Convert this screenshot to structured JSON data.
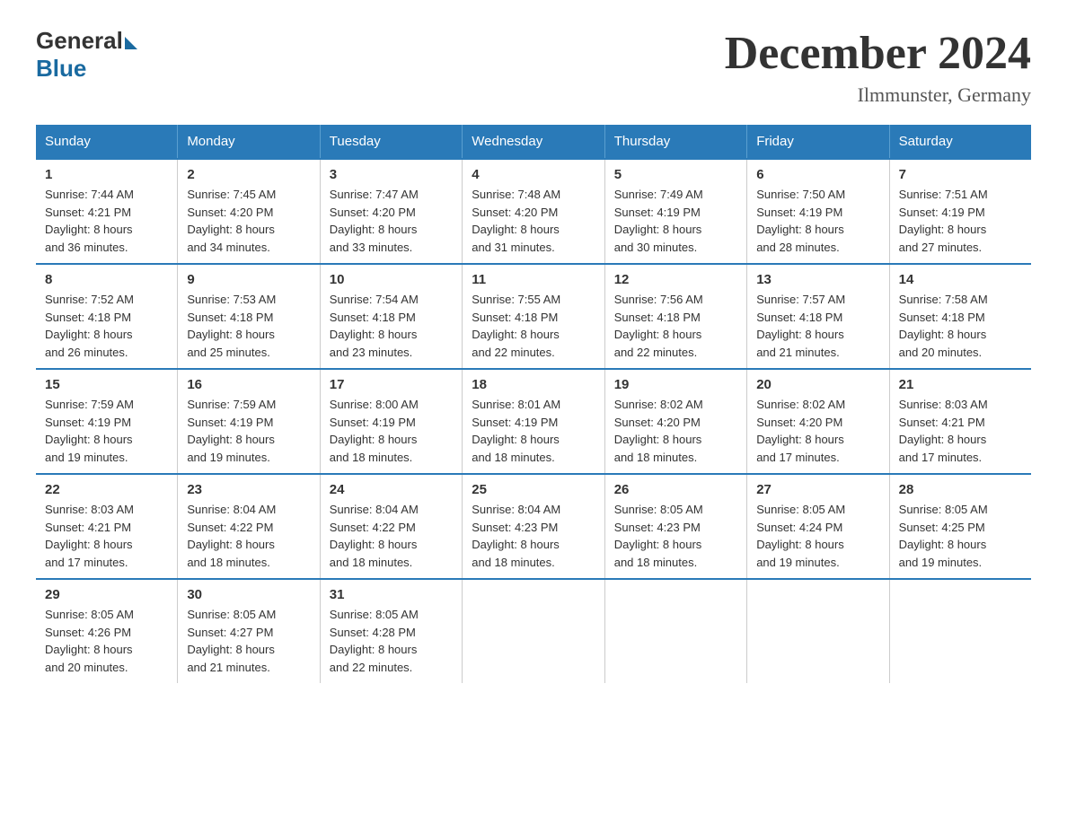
{
  "logo": {
    "general": "General",
    "blue": "Blue"
  },
  "header": {
    "title": "December 2024",
    "location": "Ilmmunster, Germany"
  },
  "weekdays": [
    "Sunday",
    "Monday",
    "Tuesday",
    "Wednesday",
    "Thursday",
    "Friday",
    "Saturday"
  ],
  "weeks": [
    [
      {
        "day": "1",
        "sunrise": "7:44 AM",
        "sunset": "4:21 PM",
        "daylight": "8 hours and 36 minutes."
      },
      {
        "day": "2",
        "sunrise": "7:45 AM",
        "sunset": "4:20 PM",
        "daylight": "8 hours and 34 minutes."
      },
      {
        "day": "3",
        "sunrise": "7:47 AM",
        "sunset": "4:20 PM",
        "daylight": "8 hours and 33 minutes."
      },
      {
        "day": "4",
        "sunrise": "7:48 AM",
        "sunset": "4:20 PM",
        "daylight": "8 hours and 31 minutes."
      },
      {
        "day": "5",
        "sunrise": "7:49 AM",
        "sunset": "4:19 PM",
        "daylight": "8 hours and 30 minutes."
      },
      {
        "day": "6",
        "sunrise": "7:50 AM",
        "sunset": "4:19 PM",
        "daylight": "8 hours and 28 minutes."
      },
      {
        "day": "7",
        "sunrise": "7:51 AM",
        "sunset": "4:19 PM",
        "daylight": "8 hours and 27 minutes."
      }
    ],
    [
      {
        "day": "8",
        "sunrise": "7:52 AM",
        "sunset": "4:18 PM",
        "daylight": "8 hours and 26 minutes."
      },
      {
        "day": "9",
        "sunrise": "7:53 AM",
        "sunset": "4:18 PM",
        "daylight": "8 hours and 25 minutes."
      },
      {
        "day": "10",
        "sunrise": "7:54 AM",
        "sunset": "4:18 PM",
        "daylight": "8 hours and 23 minutes."
      },
      {
        "day": "11",
        "sunrise": "7:55 AM",
        "sunset": "4:18 PM",
        "daylight": "8 hours and 22 minutes."
      },
      {
        "day": "12",
        "sunrise": "7:56 AM",
        "sunset": "4:18 PM",
        "daylight": "8 hours and 22 minutes."
      },
      {
        "day": "13",
        "sunrise": "7:57 AM",
        "sunset": "4:18 PM",
        "daylight": "8 hours and 21 minutes."
      },
      {
        "day": "14",
        "sunrise": "7:58 AM",
        "sunset": "4:18 PM",
        "daylight": "8 hours and 20 minutes."
      }
    ],
    [
      {
        "day": "15",
        "sunrise": "7:59 AM",
        "sunset": "4:19 PM",
        "daylight": "8 hours and 19 minutes."
      },
      {
        "day": "16",
        "sunrise": "7:59 AM",
        "sunset": "4:19 PM",
        "daylight": "8 hours and 19 minutes."
      },
      {
        "day": "17",
        "sunrise": "8:00 AM",
        "sunset": "4:19 PM",
        "daylight": "8 hours and 18 minutes."
      },
      {
        "day": "18",
        "sunrise": "8:01 AM",
        "sunset": "4:19 PM",
        "daylight": "8 hours and 18 minutes."
      },
      {
        "day": "19",
        "sunrise": "8:02 AM",
        "sunset": "4:20 PM",
        "daylight": "8 hours and 18 minutes."
      },
      {
        "day": "20",
        "sunrise": "8:02 AM",
        "sunset": "4:20 PM",
        "daylight": "8 hours and 17 minutes."
      },
      {
        "day": "21",
        "sunrise": "8:03 AM",
        "sunset": "4:21 PM",
        "daylight": "8 hours and 17 minutes."
      }
    ],
    [
      {
        "day": "22",
        "sunrise": "8:03 AM",
        "sunset": "4:21 PM",
        "daylight": "8 hours and 17 minutes."
      },
      {
        "day": "23",
        "sunrise": "8:04 AM",
        "sunset": "4:22 PM",
        "daylight": "8 hours and 18 minutes."
      },
      {
        "day": "24",
        "sunrise": "8:04 AM",
        "sunset": "4:22 PM",
        "daylight": "8 hours and 18 minutes."
      },
      {
        "day": "25",
        "sunrise": "8:04 AM",
        "sunset": "4:23 PM",
        "daylight": "8 hours and 18 minutes."
      },
      {
        "day": "26",
        "sunrise": "8:05 AM",
        "sunset": "4:23 PM",
        "daylight": "8 hours and 18 minutes."
      },
      {
        "day": "27",
        "sunrise": "8:05 AM",
        "sunset": "4:24 PM",
        "daylight": "8 hours and 19 minutes."
      },
      {
        "day": "28",
        "sunrise": "8:05 AM",
        "sunset": "4:25 PM",
        "daylight": "8 hours and 19 minutes."
      }
    ],
    [
      {
        "day": "29",
        "sunrise": "8:05 AM",
        "sunset": "4:26 PM",
        "daylight": "8 hours and 20 minutes."
      },
      {
        "day": "30",
        "sunrise": "8:05 AM",
        "sunset": "4:27 PM",
        "daylight": "8 hours and 21 minutes."
      },
      {
        "day": "31",
        "sunrise": "8:05 AM",
        "sunset": "4:28 PM",
        "daylight": "8 hours and 22 minutes."
      },
      null,
      null,
      null,
      null
    ]
  ],
  "labels": {
    "sunrise": "Sunrise:",
    "sunset": "Sunset:",
    "daylight": "Daylight:"
  }
}
